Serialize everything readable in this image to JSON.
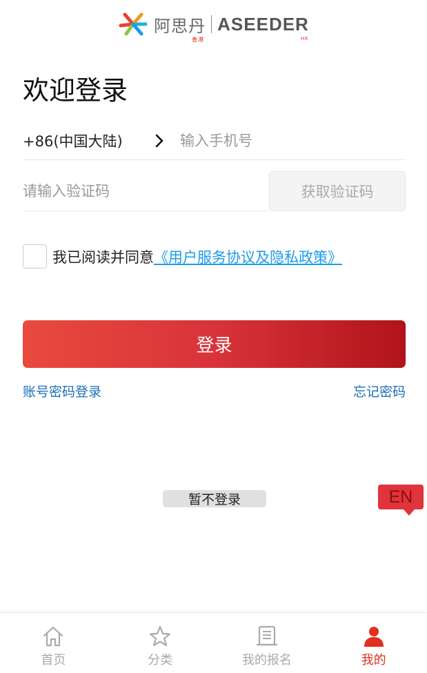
{
  "logo": {
    "cn": "阿思丹",
    "cn_sub": "香港",
    "en": "ASEEDER",
    "en_sub": "HK"
  },
  "title": "欢迎登录",
  "phone": {
    "country_code": "+86(中国大陆)",
    "placeholder": "输入手机号"
  },
  "code": {
    "placeholder": "请输入验证码",
    "button": "获取验证码"
  },
  "agreement": {
    "text": "我已阅读并同意",
    "link": "《用户服务协议及隐私政策》"
  },
  "login_button": "登录",
  "links": {
    "password_login": "账号密码登录",
    "forgot_password": "忘记密码"
  },
  "skip_login": "暂不登录",
  "language_toggle": "EN",
  "colors": {
    "brand_red": "#e0301e",
    "link_blue": "#1b6db9",
    "agreement_link": "#1a9bea"
  },
  "tabbar": {
    "items": [
      {
        "label": "首页",
        "icon": "home-icon",
        "active": false
      },
      {
        "label": "分类",
        "icon": "star-icon",
        "active": false
      },
      {
        "label": "我的报名",
        "icon": "document-icon",
        "active": false
      },
      {
        "label": "我的",
        "icon": "user-icon",
        "active": true
      }
    ]
  }
}
